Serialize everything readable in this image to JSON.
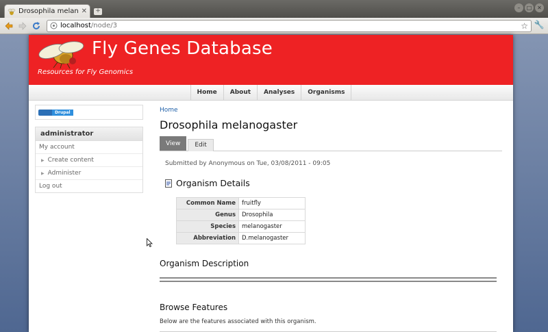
{
  "browser": {
    "tab_title": "Drosophila melanoga...",
    "url_host": "localhost",
    "url_path": "/node/3"
  },
  "site": {
    "name": "Fly Genes Database",
    "slogan": "Resources for Fly Genomics",
    "header_color": "#ee2224"
  },
  "nav": {
    "items": [
      "Home",
      "About",
      "Analyses",
      "Organisms"
    ]
  },
  "sidebar": {
    "powered_by": "Drupal",
    "user_block_title": "administrator",
    "links": [
      "My account",
      "Create content",
      "Administer",
      "Log out"
    ]
  },
  "content": {
    "breadcrumb": "Home",
    "title": "Drosophila melanogaster",
    "tabs": [
      "View",
      "Edit"
    ],
    "submitted": "Submitted by Anonymous on Tue, 03/08/2011 - 09:05",
    "details_heading": "Organism Details",
    "details": [
      {
        "label": "Common Name",
        "value": "fruitfly"
      },
      {
        "label": "Genus",
        "value": "Drosophila"
      },
      {
        "label": "Species",
        "value": "melanogaster"
      },
      {
        "label": "Abbreviation",
        "value": "D.melanogaster"
      }
    ],
    "description_heading": "Organism Description",
    "browse_heading": "Browse Features",
    "browse_text": "Below are the features associated with this organism."
  },
  "icons": {
    "back": "back-arrow-icon",
    "forward": "forward-arrow-icon",
    "reload": "reload-icon",
    "bookmark": "star-icon",
    "menu": "wrench-icon"
  }
}
